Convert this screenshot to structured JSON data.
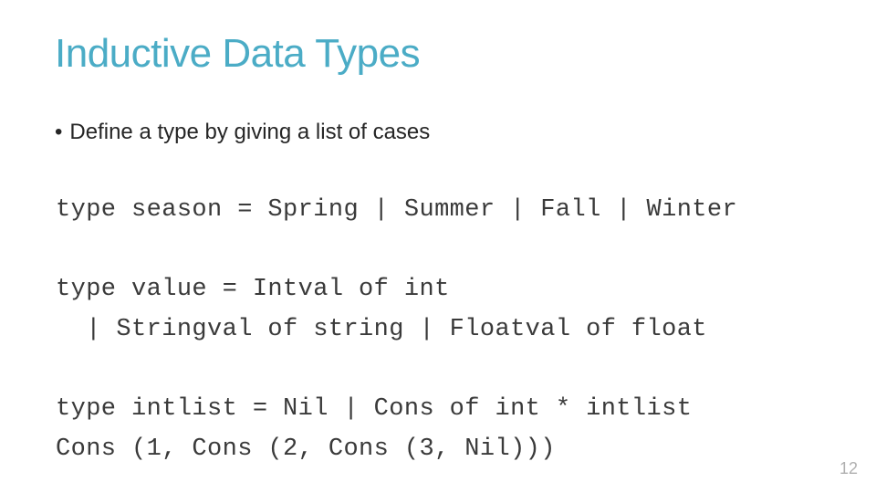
{
  "slide": {
    "title": "Inductive Data Types",
    "bullet_marker": "•",
    "bullet_text": "Define a type by giving a list of cases",
    "code_lines": [
      "type season = Spring | Summer | Fall | Winter",
      "type value = Intval of int",
      "  | Stringval of string | Floatval of float",
      "type intlist = Nil | Cons of int * intlist",
      "Cons (1, Cons (2, Cons (3, Nil)))"
    ],
    "page_number": "12"
  },
  "colors": {
    "title": "#4bacc6",
    "body_text": "#262626",
    "code_text": "#3a3a3a",
    "page_number": "#b0b0b0"
  }
}
